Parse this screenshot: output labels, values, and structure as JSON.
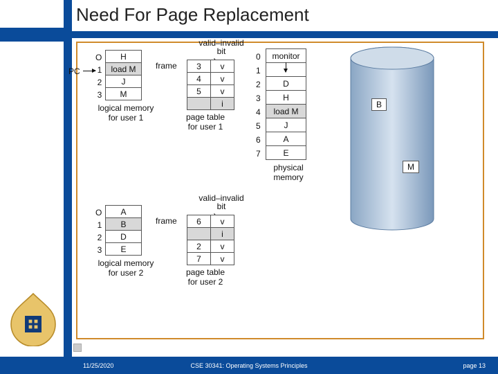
{
  "title": "Need For Page Replacement",
  "footer": {
    "date": "11/25/2020",
    "course": "CSE 30341: Operating Systems Principles",
    "page": "page 13"
  },
  "pc_label": "PC",
  "logical1": {
    "label": "logical memory\nfor user 1",
    "idx": [
      "O",
      "1",
      "2",
      "3"
    ],
    "rows": [
      "H",
      "load M",
      "J",
      "M"
    ],
    "hl": [
      1
    ]
  },
  "pt1": {
    "label": "page table\nfor user 1",
    "frame_lbl": "frame",
    "vib_lbl": "valid–invalid\nbit",
    "rows": [
      [
        "3",
        "v"
      ],
      [
        "4",
        "v"
      ],
      [
        "5",
        "v"
      ],
      [
        "",
        "i"
      ]
    ]
  },
  "logical2": {
    "label": "logical memory\nfor user 2",
    "idx": [
      "O",
      "1",
      "2",
      "3"
    ],
    "rows": [
      "A",
      "B",
      "D",
      "E"
    ],
    "hl": [
      1
    ]
  },
  "pt2": {
    "label": "page table\nfor user 2",
    "frame_lbl": "frame",
    "vib_lbl": "valid–invalid\nbit",
    "rows": [
      [
        "6",
        "v"
      ],
      [
        "",
        "i"
      ],
      [
        "2",
        "v"
      ],
      [
        "7",
        "v"
      ]
    ]
  },
  "physical": {
    "label": "physical\nmemory",
    "idx": [
      "0",
      "1",
      "2",
      "3",
      "4",
      "5",
      "6",
      "7"
    ],
    "rows": [
      "monitor",
      "",
      "D",
      "H",
      "load M",
      "J",
      "A",
      "E"
    ],
    "hl": [
      4
    ]
  },
  "disk": {
    "b": "B",
    "m": "M"
  }
}
